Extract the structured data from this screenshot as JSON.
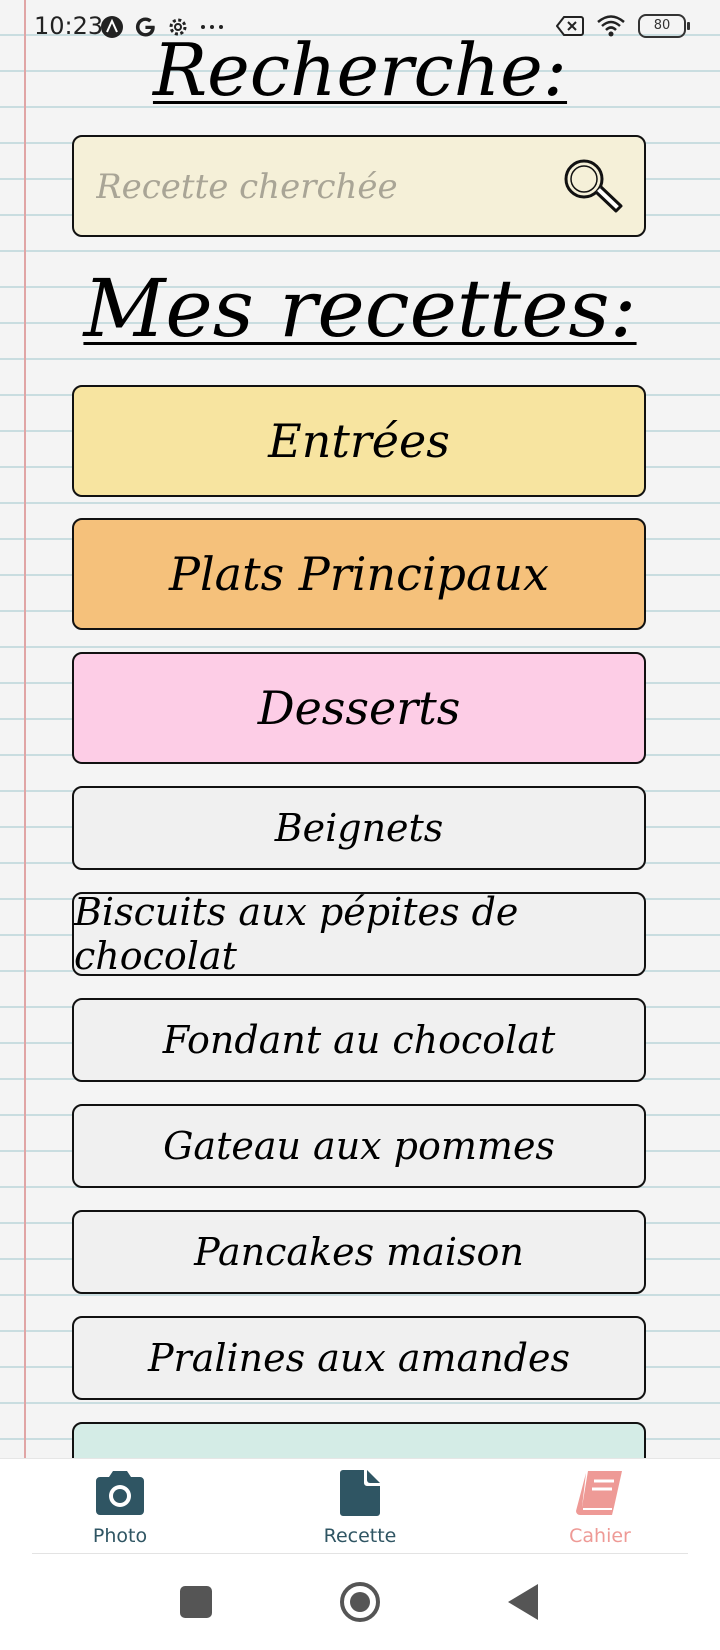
{
  "statusbar": {
    "time": "10:23",
    "battery": "80",
    "icons_left": [
      "app-a-icon",
      "google-icon",
      "settings-icon",
      "more-dots-icon"
    ],
    "icons_right": [
      "no-signal-icon",
      "wifi-icon",
      "battery-icon"
    ]
  },
  "search": {
    "title": "Recherche:",
    "placeholder": "Recette cherchée",
    "value": ""
  },
  "recipes": {
    "title": "Mes recettes:",
    "categories": [
      {
        "label": "Entrées",
        "color": "#f7e4a0"
      },
      {
        "label": "Plats Principaux",
        "color": "#f5c17b"
      },
      {
        "label": "Desserts",
        "color": "#fdcde6"
      }
    ],
    "items": [
      "Beignets",
      "Biscuits aux pépites de chocolat",
      "Fondant au chocolat",
      "Gateau aux pommes",
      "Pancakes maison",
      "Pralines aux amandes"
    ],
    "partial_item_color": "#d4ece6"
  },
  "nav": {
    "items": [
      {
        "label": "Photo",
        "icon": "camera-icon",
        "color": "#2f5563"
      },
      {
        "label": "Recette",
        "icon": "document-icon",
        "color": "#2f5563"
      },
      {
        "label": "Cahier",
        "icon": "book-icon",
        "color": "#ee9a96",
        "active": true
      }
    ]
  },
  "colors": {
    "paper": "#f4f4f4",
    "ruled_line": "#c9dde0",
    "margin_line": "#e0a5a5",
    "nav_active": "#ee9a96",
    "nav_inactive": "#2f5563"
  }
}
